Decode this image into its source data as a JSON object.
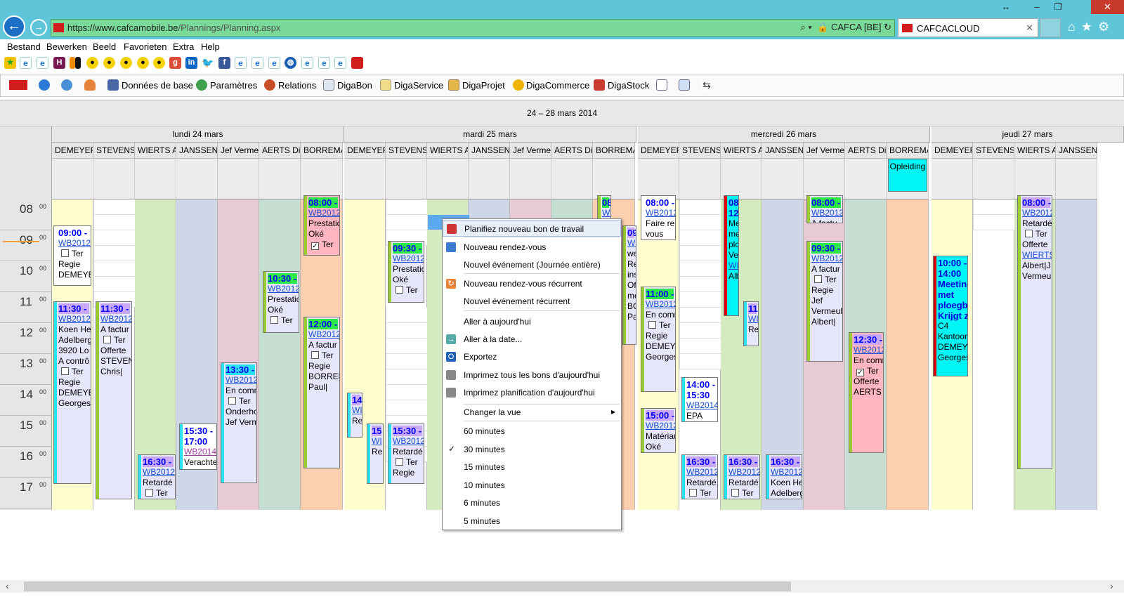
{
  "browser": {
    "url_host": "https://www.cafcamobile.be",
    "url_path": "/Plannings/Planning.aspx",
    "site_identity": "CAFCA [BE]",
    "tab_title": "CAFCACLOUD",
    "menu": [
      "Bestand",
      "Bewerken",
      "Beeld",
      "Favorieten",
      "Extra",
      "Help"
    ]
  },
  "appbar": {
    "items": [
      "Données de base",
      "Paramètres",
      "Relations",
      "DigaBon",
      "DigaService",
      "DigaProjet",
      "DigaCommerce",
      "DigaStock"
    ]
  },
  "calendar": {
    "week_title": "24 – 28 mars 2014",
    "days": [
      "lundi 24 mars",
      "mardi 25 mars",
      "mercredi 26 mars",
      "jeudi 27 mars"
    ],
    "resources": [
      "DEMEYER",
      "STEVENS C",
      "WIERTS A",
      "JANSSEN K",
      "Jef Vermeu",
      "AERTS Dirk",
      "BORREMANS"
    ],
    "resources_day4": [
      "DEMEYER",
      "STEVENS C",
      "WIERTS A",
      "JANSSEN K"
    ],
    "hours": [
      "08",
      "09",
      "10",
      "11",
      "12",
      "13",
      "14",
      "15",
      "16",
      "17"
    ],
    "minutes": "00",
    "allday_event": "Opleiding"
  },
  "events": [
    {
      "lines": [
        "09:00 -",
        "WB2012",
        "Ter",
        "Regie",
        "DEMEYE"
      ]
    },
    {
      "lines": [
        "11:30 -",
        "WB2012",
        "Koen He",
        "Adelberg",
        "3920 Lo",
        "A contrô",
        "Ter",
        "Regie",
        "DEMEYE",
        "Georges"
      ]
    },
    {
      "lines": [
        "11:30 -",
        "WB2012",
        "A factur",
        "Ter",
        "Offerte",
        "STEVEN",
        "Chris|"
      ]
    },
    {
      "lines": [
        "16:30 -",
        "WB2012",
        "Retardé",
        "Ter"
      ]
    },
    {
      "lines": [
        "15:30 -",
        "17:00",
        "WB2014",
        "Verachte"
      ]
    },
    {
      "lines": [
        "13:30 -",
        "WB2012",
        "En comm",
        "Ter",
        "Onderhou",
        "Jef Verm"
      ]
    },
    {
      "lines": [
        "10:30 -",
        "WB2012",
        "Prestatio",
        "Oké",
        "Ter"
      ]
    },
    {
      "lines": [
        "08:00 -",
        "WB2012",
        "Prestatio",
        "Oké",
        "Ter"
      ]
    },
    {
      "lines": [
        "12:00 -",
        "WB2012",
        "A factur",
        "Ter",
        "Regie",
        "BORREM",
        "Paul|"
      ]
    },
    {
      "lines": [
        "09:30 -",
        "WB2012",
        "Prestatio",
        "Oké",
        "Ter"
      ]
    },
    {
      "lines": [
        "14",
        "WI",
        "Re"
      ]
    },
    {
      "lines": [
        "15",
        "WI",
        "Re"
      ]
    },
    {
      "lines": [
        "15:30 -",
        "WB2012",
        "Retardé",
        "Ter",
        "Regie"
      ]
    },
    {
      "lines": [
        "08",
        "WI"
      ]
    },
    {
      "lines": [
        "09",
        "WI",
        "we",
        "Re",
        "ins",
        "Of",
        "me",
        "BO",
        "Pa"
      ]
    },
    {
      "lines": [
        "08:00 -",
        "WB2012",
        "Faire rei",
        "vous"
      ]
    },
    {
      "lines": [
        "11:00 -",
        "WB2012",
        "En comm",
        "Ter",
        "Regie",
        "DEMEYE",
        "Georges"
      ]
    },
    {
      "lines": [
        "15:00 -",
        "WB2012",
        "Matériau",
        "Oké"
      ]
    },
    {
      "lines": [
        "14:00 -",
        "15:30",
        "WB2014",
        "EPA"
      ]
    },
    {
      "lines": [
        "16:30 -",
        "WB2012",
        "Retardé",
        "Ter"
      ]
    },
    {
      "lines": [
        "08",
        "12",
        "Me",
        "me",
        "plo",
        "Ve",
        "WI",
        "Alb"
      ]
    },
    {
      "lines": [
        "11",
        "WI",
        "Re"
      ]
    },
    {
      "lines": [
        "16:30 -",
        "WB2012",
        "Retardé",
        "Ter"
      ]
    },
    {
      "lines": [
        "16:30 -",
        "WB2012",
        "Koen He",
        "Adelberg"
      ]
    },
    {
      "lines": [
        "08:00 -",
        "WB2012",
        "A factu"
      ]
    },
    {
      "lines": [
        "09:30 -",
        "WB2012",
        "A factur",
        "Ter",
        "Regie",
        "Jef",
        "Vermeul",
        "Albert|"
      ]
    },
    {
      "lines": [
        "12:30 -",
        "WB2012",
        "En comm",
        "Ter",
        "Offerte",
        "AERTS D"
      ]
    },
    {
      "lines": [
        "10:00 -",
        "14:00",
        "Meeting",
        "met",
        "ploegba",
        "Krijgt zij",
        "C4",
        "Kantoor",
        "DEMEYE",
        "Georges"
      ]
    },
    {
      "lines": [
        "08:00 -",
        "WB2012",
        "Retardé",
        "Ter",
        "Offerte",
        "WIERTS",
        "Albert|J",
        "Vermeul"
      ]
    }
  ],
  "context_menu": [
    "Planifiez nouveau bon de travail",
    "Nouveau rendez-vous",
    "Nouvel événement (Journée entière)",
    "Nouveau rendez-vous récurrent",
    "Nouvel événement récurrent",
    "Aller à aujourd'hui",
    "Aller à la date...",
    "Exportez",
    "Imprimez tous les bons d'aujourd'hui",
    "Imprimez planification d'aujourd'hui",
    "Changer la vue",
    "60 minutes",
    "30 minutes",
    "15 minutes",
    "10 minutes",
    "6 minutes",
    "5 minutes"
  ],
  "context_menu_checked": "30 minutes",
  "context_menu_submenu_arrow": "▸",
  "context_menu_check": "✓",
  "colors": {
    "accent_titlebar": "#5fc6d9",
    "address_bar": "#79d996",
    "time_green": "#2ee84a",
    "time_cyan": "#2be0f0",
    "time_purple": "#c9a8f5"
  }
}
